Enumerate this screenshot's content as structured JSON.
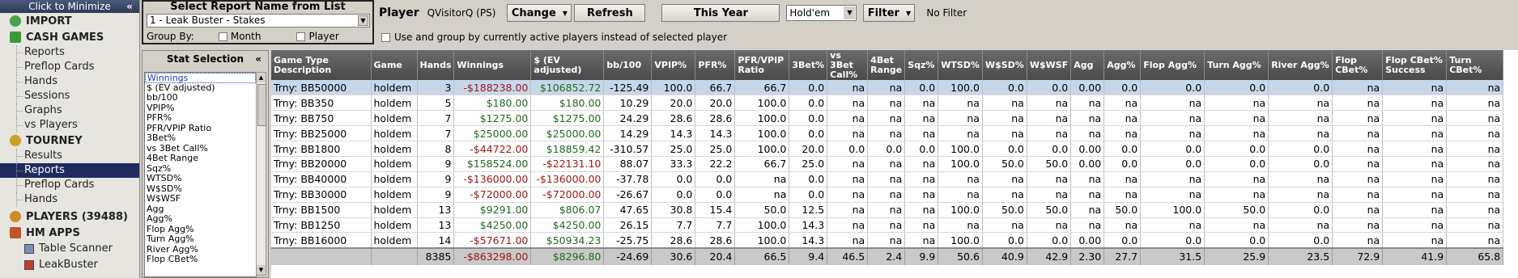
{
  "nav": {
    "minimize_label": "Click to Minimize",
    "minimize_icon": "«",
    "sections": {
      "import": "IMPORT",
      "cash_games": "CASH GAMES",
      "tourney": "TOURNEY",
      "players": "PLAYERS (39488)",
      "hm_apps": "HM APPS"
    },
    "cash_items": [
      "Reports",
      "Preflop Cards",
      "Hands",
      "Sessions",
      "Graphs",
      "vs Players"
    ],
    "tourney_items": [
      "Results",
      "Reports",
      "Preflop Cards",
      "Hands"
    ],
    "app_items": [
      "Table Scanner",
      "LeakBuster"
    ]
  },
  "report_panel": {
    "title": "Select Report Name from List",
    "selected": "1 - Leak Buster - Stakes",
    "group_by_label": "Group By:",
    "month_label": "Month",
    "player_label": "Player"
  },
  "toolbar": {
    "player_label": "Player",
    "player_value": "QVisitorQ (PS)",
    "change_label": "Change",
    "refresh_label": "Refresh",
    "this_year_label": "This Year",
    "game_value": "Hold'em",
    "filter_label": "Filter",
    "no_filter_text": "No Filter",
    "use_group_label": "Use and group by currently active players instead of selected player"
  },
  "stat_panel": {
    "title": "Stat Selection",
    "collapse_icon": "«",
    "items": [
      "Winnings",
      "$ (EV adjusted)",
      "bb/100",
      "VPIP%",
      "PFR%",
      "PFR/VPIP Ratio",
      "3Bet%",
      "vs 3Bet Call%",
      "4Bet Range",
      "Sqz%",
      "WTSD%",
      "W$SD%",
      "W$WSF",
      "Agg",
      "Agg%",
      "Flop Agg%",
      "Turn Agg%",
      "River Agg%",
      "Flop CBet%"
    ]
  },
  "grid": {
    "columns": [
      "Game Type Description",
      "Game",
      "Hands",
      "Winnings",
      "$ (EV adjusted)",
      "bb/100",
      "VPIP%",
      "PFR%",
      "PFR/VPIP Ratio",
      "3Bet%",
      "vs 3Bet Call%",
      "4Bet Range",
      "Sqz%",
      "WTSD%",
      "W$SD%",
      "W$WSF",
      "Agg",
      "Agg%",
      "Flop Agg%",
      "Turn Agg%",
      "River Agg%",
      "Flop CBet%",
      "Flop CBet% Success",
      "Turn CBet%"
    ],
    "rows": [
      [
        "Trny: BB50000",
        "holdem",
        "3",
        "-$188238.00",
        "$106852.72",
        "-125.49",
        "100.0",
        "66.7",
        "66.7",
        "0.0",
        "na",
        "na",
        "0.0",
        "100.0",
        "0.0",
        "0.0",
        "0.00",
        "0.0",
        "0.0",
        "0.0",
        "0.0",
        "na",
        "na",
        "na"
      ],
      [
        "Trny: BB350",
        "holdem",
        "5",
        "$180.00",
        "$180.00",
        "10.29",
        "20.0",
        "20.0",
        "100.0",
        "0.0",
        "na",
        "na",
        "na",
        "na",
        "na",
        "na",
        "na",
        "na",
        "na",
        "na",
        "na",
        "na",
        "na",
        "na"
      ],
      [
        "Trny: BB750",
        "holdem",
        "7",
        "$1275.00",
        "$1275.00",
        "24.29",
        "28.6",
        "28.6",
        "100.0",
        "0.0",
        "na",
        "na",
        "na",
        "na",
        "na",
        "na",
        "na",
        "na",
        "na",
        "na",
        "na",
        "na",
        "na",
        "na"
      ],
      [
        "Trny: BB25000",
        "holdem",
        "7",
        "$25000.00",
        "$25000.00",
        "14.29",
        "14.3",
        "14.3",
        "100.0",
        "0.0",
        "na",
        "na",
        "na",
        "na",
        "na",
        "na",
        "na",
        "na",
        "na",
        "na",
        "na",
        "na",
        "na",
        "na"
      ],
      [
        "Trny: BB1800",
        "holdem",
        "8",
        "-$44722.00",
        "$18859.42",
        "-310.57",
        "25.0",
        "25.0",
        "100.0",
        "20.0",
        "0.0",
        "0.0",
        "0.0",
        "100.0",
        "0.0",
        "0.0",
        "0.00",
        "0.0",
        "0.0",
        "0.0",
        "0.0",
        "na",
        "na",
        "na"
      ],
      [
        "Trny: BB20000",
        "holdem",
        "9",
        "$158524.00",
        "-$22131.10",
        "88.07",
        "33.3",
        "22.2",
        "66.7",
        "25.0",
        "na",
        "na",
        "na",
        "100.0",
        "50.0",
        "50.0",
        "0.00",
        "0.0",
        "0.0",
        "0.0",
        "0.0",
        "na",
        "na",
        "na"
      ],
      [
        "Trny: BB40000",
        "holdem",
        "9",
        "-$136000.00",
        "-$136000.00",
        "-37.78",
        "0.0",
        "0.0",
        "na",
        "0.0",
        "na",
        "na",
        "na",
        "na",
        "na",
        "na",
        "na",
        "na",
        "na",
        "na",
        "na",
        "na",
        "na",
        "na"
      ],
      [
        "Trny: BB30000",
        "holdem",
        "9",
        "-$72000.00",
        "-$72000.00",
        "-26.67",
        "0.0",
        "0.0",
        "na",
        "0.0",
        "na",
        "na",
        "na",
        "na",
        "na",
        "na",
        "na",
        "na",
        "na",
        "na",
        "na",
        "na",
        "na",
        "na"
      ],
      [
        "Trny: BB1500",
        "holdem",
        "13",
        "$9291.00",
        "$806.07",
        "47.65",
        "30.8",
        "15.4",
        "50.0",
        "12.5",
        "na",
        "na",
        "na",
        "100.0",
        "50.0",
        "50.0",
        "na",
        "50.0",
        "100.0",
        "50.0",
        "0.0",
        "na",
        "na",
        "na"
      ],
      [
        "Trny: BB1250",
        "holdem",
        "13",
        "$4250.00",
        "$4250.00",
        "26.15",
        "7.7",
        "7.7",
        "100.0",
        "14.3",
        "na",
        "na",
        "na",
        "na",
        "na",
        "na",
        "na",
        "na",
        "na",
        "na",
        "na",
        "na",
        "na",
        "na"
      ],
      [
        "Trny: BB16000",
        "holdem",
        "14",
        "-$57671.00",
        "$50934.23",
        "-25.75",
        "28.6",
        "28.6",
        "100.0",
        "14.3",
        "na",
        "na",
        "na",
        "100.0",
        "0.0",
        "0.0",
        "0.00",
        "0.0",
        "0.0",
        "0.0",
        "0.0",
        "na",
        "na",
        "na"
      ]
    ],
    "totals": [
      "",
      "",
      "8385",
      "-$863298.00",
      "$8296.80",
      "-24.69",
      "30.6",
      "20.4",
      "66.5",
      "9.4",
      "46.5",
      "2.4",
      "9.9",
      "50.6",
      "40.9",
      "42.9",
      "2.30",
      "27.7",
      "31.5",
      "25.9",
      "23.5",
      "72.9",
      "41.9",
      "65.8"
    ]
  },
  "colors": {
    "positive": "#1f6b1f",
    "negative": "#a01818",
    "header_bg": "#5a5a5a",
    "selected_nav": "#1f2a5e"
  }
}
